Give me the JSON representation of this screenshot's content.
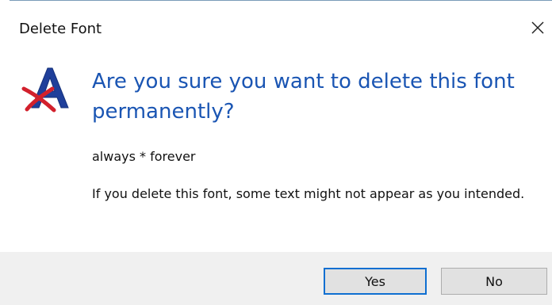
{
  "window": {
    "title": "Delete Font",
    "close_icon": "close-icon"
  },
  "message": {
    "icon": "font-delete-icon",
    "heading": "Are you sure you want to delete this font permanently?",
    "font_name": "always * forever",
    "warning": "If you delete this font, some text might not appear as you intended."
  },
  "buttons": {
    "yes_label": "Yes",
    "no_label": "No"
  },
  "colors": {
    "heading": "#1a55b3",
    "footer_background": "#f0f0f0",
    "default_button_border": "#0f6fd1",
    "icon_letter": "#1f3f9a",
    "icon_cross": "#d2202c"
  }
}
